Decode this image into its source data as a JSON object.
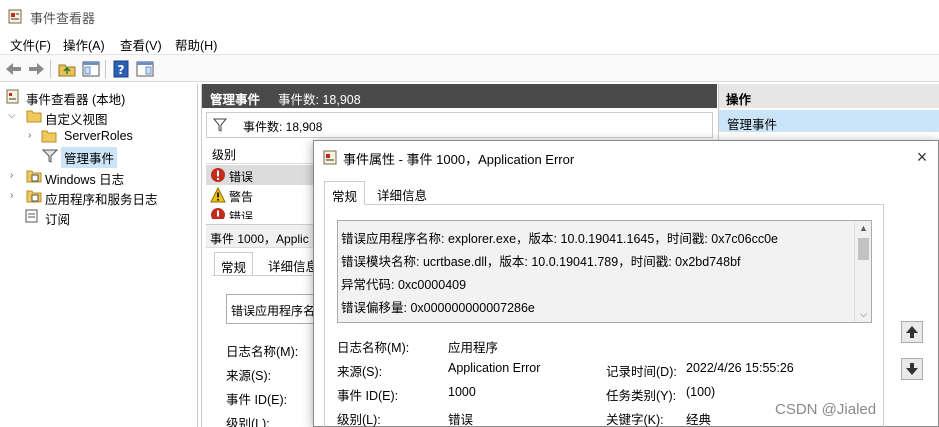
{
  "app": {
    "title": "事件查看器"
  },
  "menu": [
    "文件(F)",
    "操作(A)",
    "查看(V)",
    "帮助(H)"
  ],
  "tree": {
    "root": "事件查看器 (本地)",
    "custom_views": "自定义视图",
    "server_roles": "ServerRoles",
    "admin_events": "管理事件",
    "windows_logs": "Windows 日志",
    "app_service_logs": "应用程序和服务日志",
    "subscriptions": "订阅"
  },
  "center": {
    "header_title": "管理事件",
    "header_count": "事件数: 18,908",
    "filter_count": "事件数: 18,908",
    "column_level": "级别",
    "rows": [
      {
        "level": "错误",
        "type": "error"
      },
      {
        "level": "警告",
        "type": "warning"
      },
      {
        "level": "错误",
        "type": "error"
      }
    ],
    "detail_header": "事件 1000，Applic",
    "tab_general": "常规",
    "tab_details": "详细信息",
    "preview_text": "错误应用程序名",
    "fields": [
      "日志名称(M):",
      "来源(S):",
      "事件 ID(E):",
      "级别(L):"
    ]
  },
  "actions": {
    "header": "操作",
    "selected": "管理事件"
  },
  "dialog": {
    "title": "事件属性 - 事件 1000，Application Error",
    "close_icon": "×",
    "tab_general": "常规",
    "tab_details": "详细信息",
    "message_lines": [
      "错误应用程序名称: explorer.exe，版本: 10.0.19041.1645，时间戳: 0x7c06cc0e",
      "错误模块名称: ucrtbase.dll，版本: 10.0.19041.789，时间戳: 0x2bd748bf",
      "异常代码: 0xc0000409",
      "错误偏移量: 0x000000000007286e"
    ],
    "fields": {
      "log_name_label": "日志名称(M):",
      "log_name_value": "应用程序",
      "source_label": "来源(S):",
      "source_value": "Application Error",
      "logged_label": "记录时间(D):",
      "logged_value": "2022/4/26 15:55:26",
      "event_id_label": "事件 ID(E):",
      "event_id_value": "1000",
      "task_label": "任务类别(Y):",
      "task_value": "(100)",
      "level_label": "级别(L):",
      "level_value": "错误",
      "keywords_label": "关键字(K):",
      "keywords_value": "经典"
    }
  },
  "watermark": "CSDN @Jialed",
  "colors": {
    "header_dark": "#4a4a4a",
    "selection": "#cce4f7",
    "error_red": "#c42b1c",
    "warning_yellow": "#f2c311"
  }
}
